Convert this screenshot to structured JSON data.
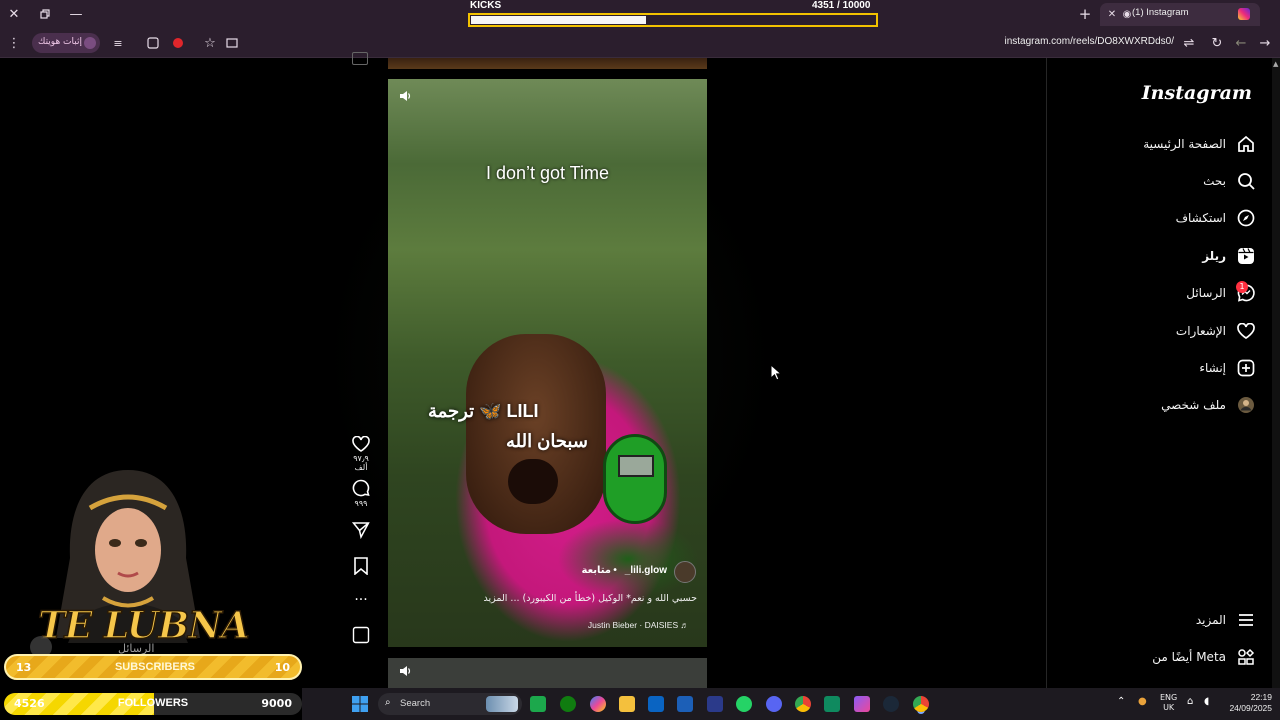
{
  "browser": {
    "tab_title": "(1) Instagram",
    "url": "instagram.com/reels/DO8XWXRDds0/",
    "verify_label": "إثبات هويتك"
  },
  "kicks": {
    "label": "KICKS",
    "count_text": "4351  / 10000",
    "current": 4351,
    "goal": 10000
  },
  "instagram": {
    "logo": "Instagram",
    "nav": [
      {
        "label": "الصفحة الرئيسية",
        "icon": "home-icon"
      },
      {
        "label": "بحث",
        "icon": "search-icon"
      },
      {
        "label": "استكشاف",
        "icon": "compass-icon"
      },
      {
        "label": "ريلز",
        "icon": "reels-icon"
      },
      {
        "label": "الرسائل",
        "icon": "messenger-icon",
        "badge": "1"
      },
      {
        "label": "الإشعارات",
        "icon": "heart-icon"
      },
      {
        "label": "إنشاء",
        "icon": "plus-square-icon"
      },
      {
        "label": "ملف شخصي",
        "icon": "profile-avatar-icon"
      }
    ],
    "more_label": "المزيد",
    "meta_label": "أيضًا من Meta"
  },
  "reel": {
    "top_caption": "I don’t got Time",
    "translation_line1": "ترجمة 🦋 LILI",
    "translation_line2": "سبحان الله",
    "username": "_lili.glow",
    "follow_label": "متابعة",
    "separator": "•",
    "description": "حسبي الله و نعم* الوكيل (خطأ من الكيبورد) ... المزيد",
    "music": "Justin Bieber · DAISIES ♬",
    "likes": "٩٧٫٩ ألف",
    "comments": "٩٩٩"
  },
  "overlay": {
    "streamer_name": "TE LUBNA",
    "messages_ghost": "الرسائل",
    "subscribers": {
      "label": "SUBSCRIBERS",
      "current": "13",
      "goal": "10"
    },
    "followers": {
      "label": "FOLLOWERS",
      "current": "4526",
      "goal": "9000",
      "fraction": 0.503
    }
  },
  "taskbar": {
    "search_placeholder": "Search",
    "lang_line1": "ENG",
    "lang_line2": "UK",
    "time": "22:19",
    "date": "24/09/2025"
  }
}
